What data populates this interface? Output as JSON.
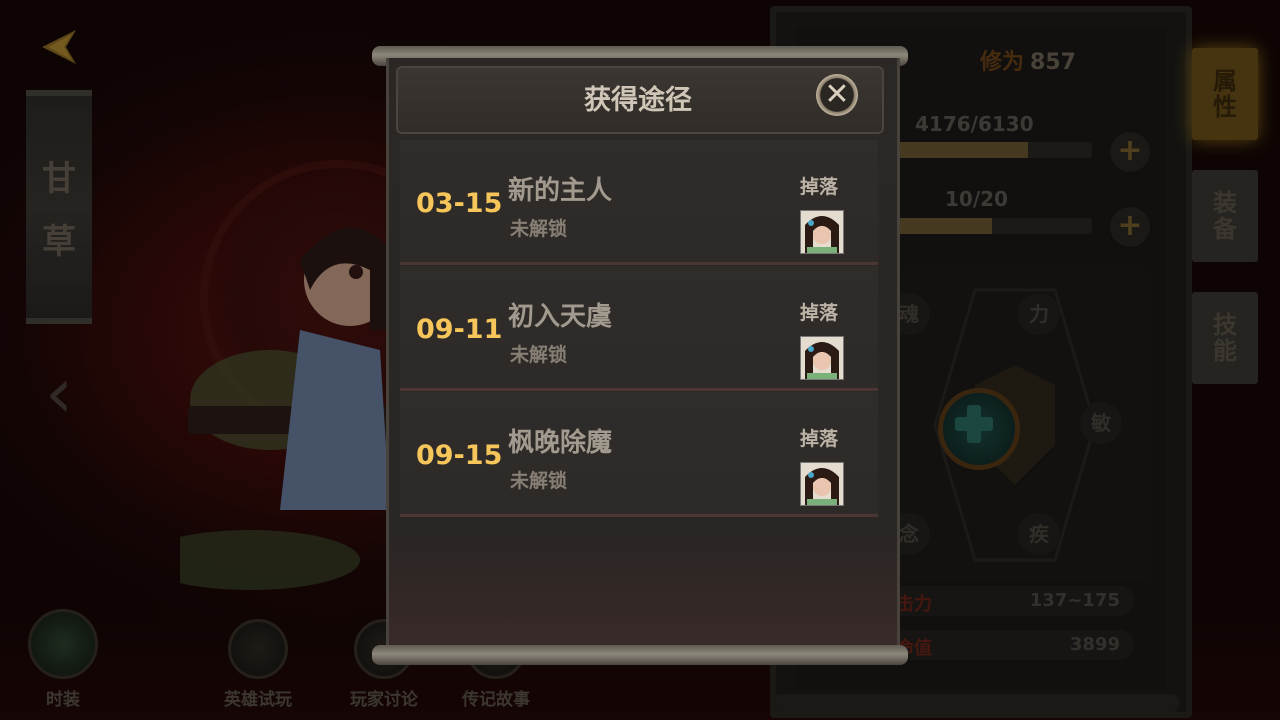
{
  "hero": {
    "name_chars": [
      "甘",
      "草"
    ]
  },
  "bottom_menu": [
    {
      "label": "时装",
      "icon": "armor-icon"
    },
    {
      "label": "英雄试玩",
      "icon": "lightning-icon"
    },
    {
      "label": "玩家讨论",
      "icon": "chat-icon"
    },
    {
      "label": "传记故事",
      "icon": "book-icon"
    }
  ],
  "right_panel": {
    "cultivation_label": "修为",
    "cultivation_value": "857",
    "exp_text": "4176/6130",
    "exp_progress": 0.68,
    "level_text": "10/20",
    "level_progress": 0.5,
    "attributes": [
      "魂",
      "力",
      "敏",
      "疾",
      "念"
    ],
    "stats": [
      {
        "label": "击力",
        "value": "137~175"
      },
      {
        "label": "命值",
        "value": "3899"
      }
    ],
    "tabs": [
      {
        "label_top": "属",
        "label_bottom": "性",
        "active": true
      },
      {
        "label_top": "装",
        "label_bottom": "备",
        "active": false
      },
      {
        "label_top": "技",
        "label_bottom": "能",
        "active": false
      }
    ]
  },
  "dialog": {
    "title": "获得途径",
    "routes": [
      {
        "stage": "03-15",
        "name": "新的主人",
        "status": "未解锁",
        "drop_label": "掉落"
      },
      {
        "stage": "09-11",
        "name": "初入天虞",
        "status": "未解锁",
        "drop_label": "掉落"
      },
      {
        "stage": "09-15",
        "name": "枫晚除魔",
        "status": "未解锁",
        "drop_label": "掉落"
      }
    ]
  },
  "colors": {
    "stage_number": "#f7c65a",
    "accent_tab": "#6b5118"
  }
}
